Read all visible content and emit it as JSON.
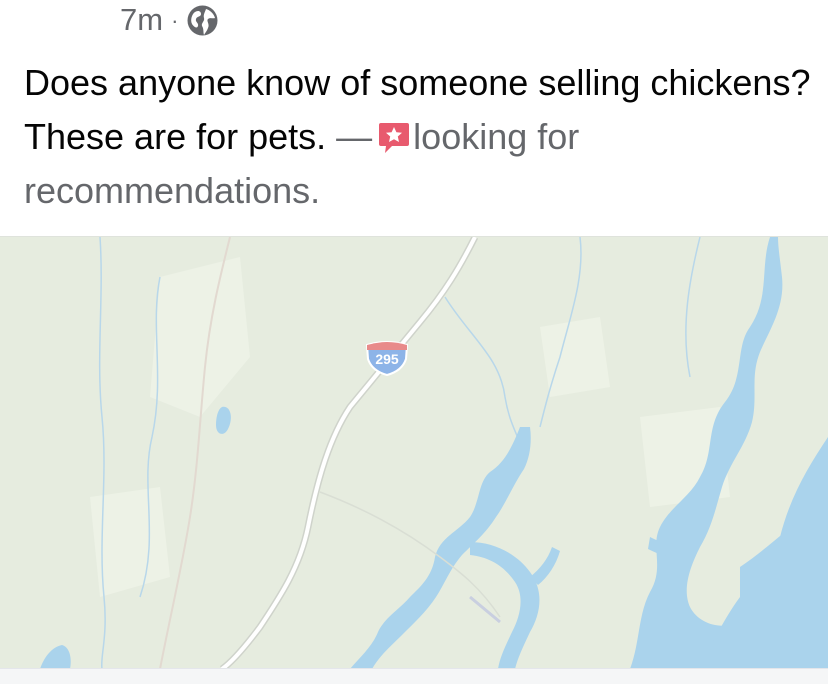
{
  "post": {
    "timestamp": "7m",
    "separator": "·",
    "privacy_icon": "globe-icon",
    "text": "Does anyone know of someone selling chickens?  These are for pets.",
    "dash": "—",
    "activity_icon": "star-speech-bubble-icon",
    "activity": "looking for recommendations."
  },
  "map": {
    "highway_shield": "295",
    "colors": {
      "land": "#e6ecdf",
      "water": "#aad3ec",
      "road": "#ffffff",
      "shield": "#8db4e8"
    }
  }
}
